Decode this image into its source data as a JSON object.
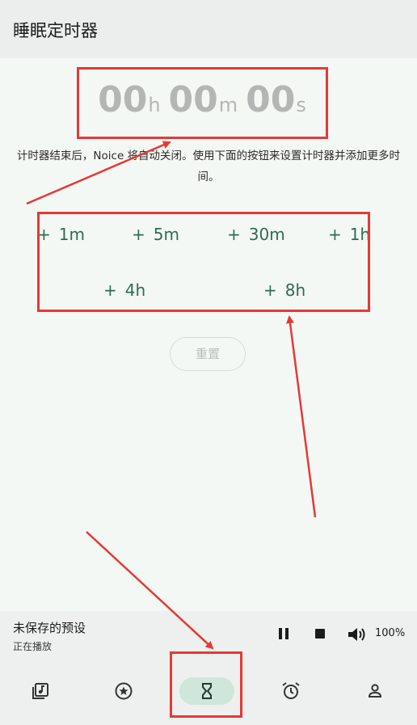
{
  "app": {
    "title": "睡眠定时器"
  },
  "timer": {
    "hours": "00",
    "hours_unit": "h",
    "minutes": "00",
    "minutes_unit": "m",
    "seconds": "00",
    "seconds_unit": "s"
  },
  "description": "计时器结束后，Noice 将自动关闭。使用下面的按钮来设置计时器并添加更多时间。",
  "add_buttons": [
    {
      "plus": "+",
      "label": "1m"
    },
    {
      "plus": "+",
      "label": "5m"
    },
    {
      "plus": "+",
      "label": "30m"
    },
    {
      "plus": "+",
      "label": "1h"
    },
    {
      "plus": "+",
      "label": "4h"
    },
    {
      "plus": "+",
      "label": "8h"
    }
  ],
  "reset_label": "重置",
  "player": {
    "preset_name": "未保存的预设",
    "status": "正在播放",
    "volume": "100%"
  },
  "bottom_nav": {
    "items": [
      {
        "icon": "library-music-icon"
      },
      {
        "icon": "presets-star-icon"
      },
      {
        "icon": "hourglass-icon",
        "active": true
      },
      {
        "icon": "alarm-clock-icon"
      },
      {
        "icon": "account-icon"
      }
    ]
  },
  "colors": {
    "accent": "#2e6b55",
    "active_nav_bg": "#cfe6da",
    "annotation": "#e53935"
  }
}
